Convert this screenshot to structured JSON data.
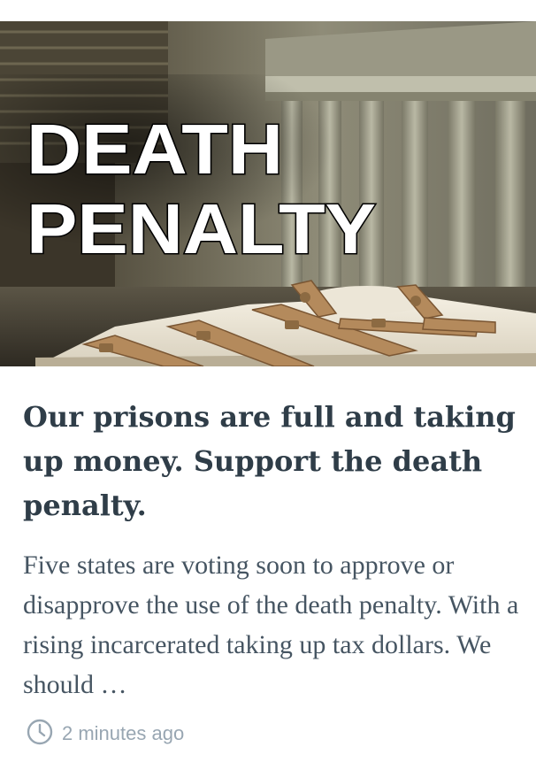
{
  "article": {
    "image": {
      "icon": "death-penalty-photo",
      "overlay_line1": "DEATH",
      "overlay_line2": "PENALTY"
    },
    "headline": "Our prisons are full and taking up money. Support the death penalty.",
    "excerpt": "Five states are voting soon to approve or disapprove the use of the death penalty. With a rising incarcerated taking up tax dollars. We should …",
    "meta": {
      "icon": "clock-icon",
      "timestamp": "2 minutes ago"
    }
  },
  "colors": {
    "headline": "#2f3d48",
    "excerpt": "#465562",
    "meta": "#98a6b2"
  }
}
